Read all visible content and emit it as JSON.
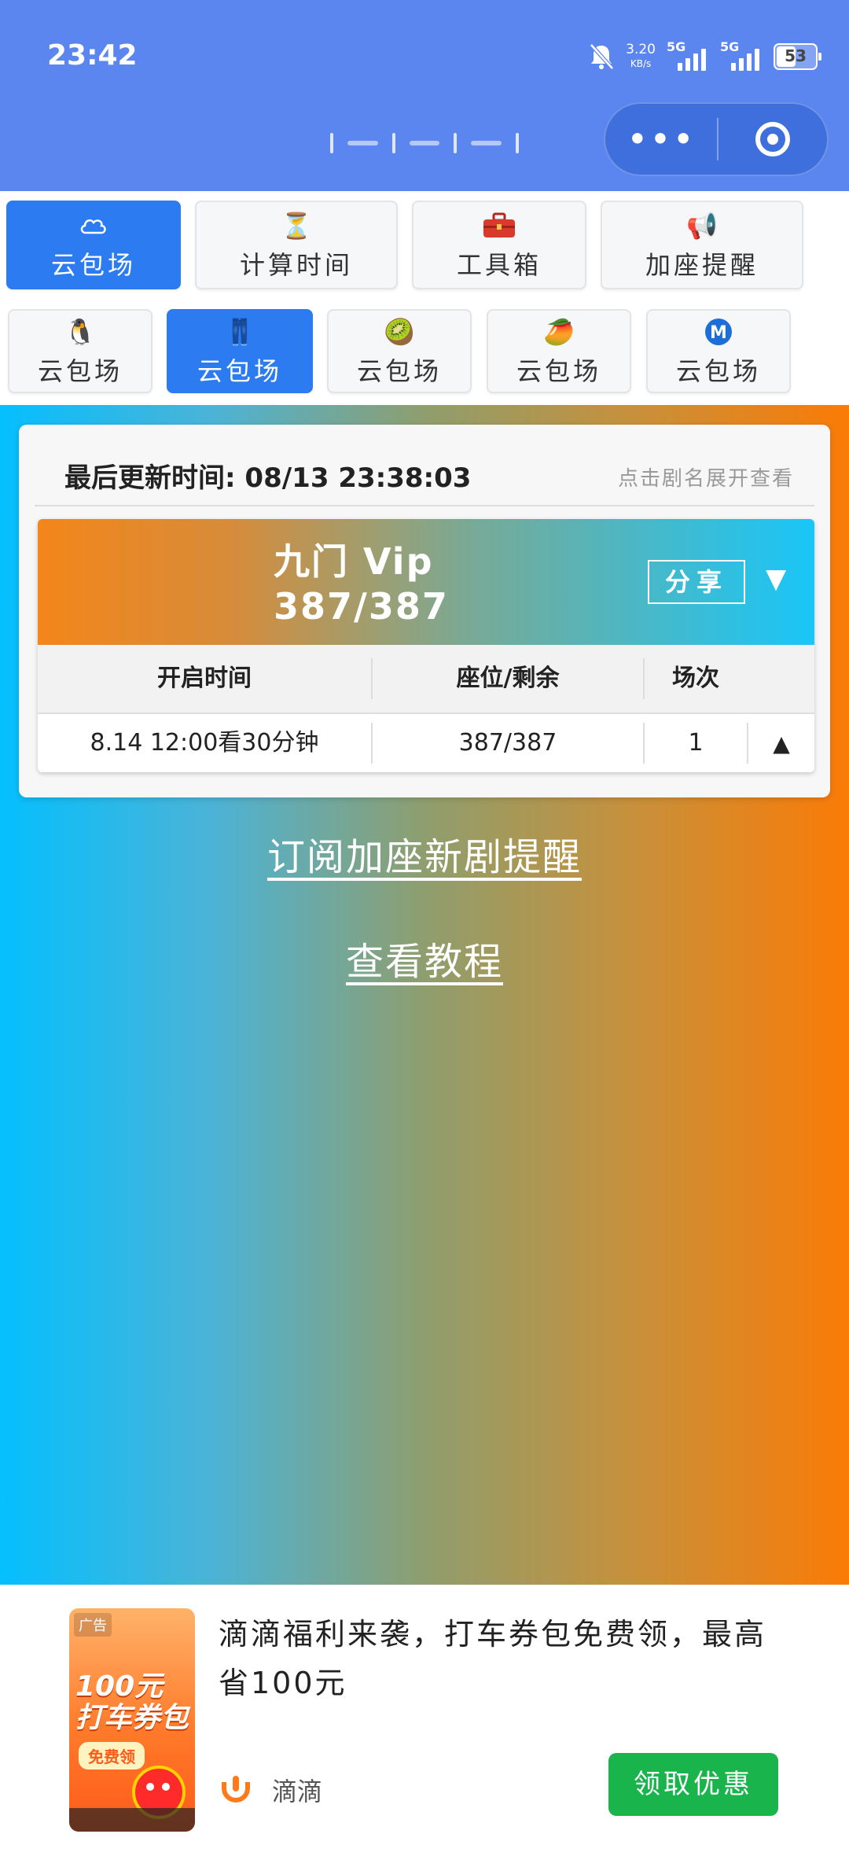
{
  "status_bar": {
    "time": "23:42",
    "net_speed_value": "3.20",
    "net_speed_unit": "KB/s",
    "signal1": "5G",
    "signal2": "5G",
    "battery": "53",
    "battery_level": 0.53
  },
  "tabs_row1": [
    {
      "label": "云包场",
      "icon": "cloud-icon",
      "active": true
    },
    {
      "label": "计算时间",
      "icon": "hourglass-icon",
      "active": false
    },
    {
      "label": "工具箱",
      "icon": "toolbox-icon",
      "active": false
    },
    {
      "label": "加座提醒",
      "icon": "megaphone-icon",
      "active": false
    }
  ],
  "tabs_row2": [
    {
      "label": "云包场",
      "icon": "penguin-icon",
      "emoji": "🐧",
      "active": false
    },
    {
      "label": "云包场",
      "icon": "jeans-icon",
      "emoji": "👖",
      "active": true
    },
    {
      "label": "云包场",
      "icon": "kiwi-icon",
      "emoji": "🥝",
      "active": false
    },
    {
      "label": "云包场",
      "icon": "mango-icon",
      "emoji": "🥭",
      "active": false
    },
    {
      "label": "云包场",
      "icon": "metro-m-icon",
      "emoji": "Ⓜ",
      "active": false
    }
  ],
  "card": {
    "last_update": "最后更新时间: 08/13 23:38:03",
    "hint": "点击剧名展开查看",
    "show": {
      "name": "九门 Vip",
      "count": "387/387",
      "share_label": "分享",
      "expand_icon": "▼"
    },
    "table": {
      "headers": [
        "开启时间",
        "座位/剩余",
        "场次"
      ],
      "rows": [
        {
          "time": "8.14 12:00看30分钟",
          "seats": "387/387",
          "session": "1",
          "toggle": "▲"
        }
      ]
    }
  },
  "links": {
    "subscribe": "订阅加座新剧提醒",
    "tutorial": "查看教程"
  },
  "ad": {
    "image_tag": "广告",
    "image_big": "100元\n打车券包",
    "image_sub": "免费领",
    "title": "滴滴福利来袭，打车券包免费领，最高省100元",
    "brand": "滴滴",
    "button": "领取优惠"
  },
  "colors": {
    "header_bg": "#5b86ef",
    "active_tab": "#2c7bf0",
    "ad_button": "#1ab44c",
    "gradient_left": "#04bffe",
    "gradient_right": "#fb7b06"
  }
}
